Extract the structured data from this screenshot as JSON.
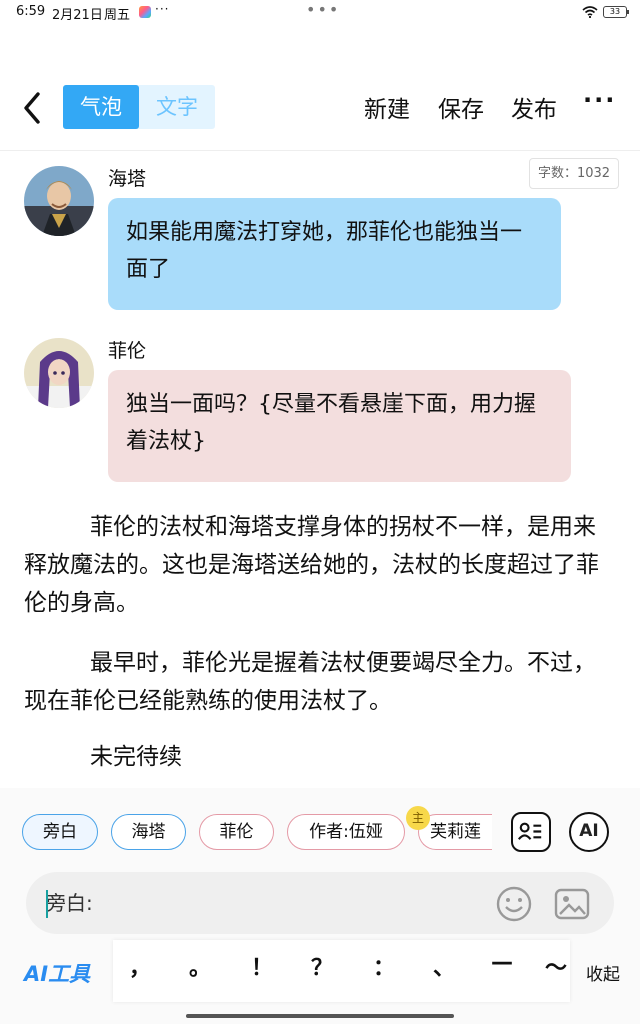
{
  "status_bar": {
    "time": "6:59",
    "date": "2月21日",
    "weekday": "周五",
    "more": "···",
    "center_dots": "•••",
    "battery": "33"
  },
  "toolbar": {
    "tab_bubble": "气泡",
    "tab_text": "文字",
    "new_label": "新建",
    "save_label": "保存",
    "publish_label": "发布",
    "more_label": "···"
  },
  "word_count": "字数：1032",
  "messages": [
    {
      "speaker": "海塔",
      "text": "如果能用魔法打穿她，那菲伦也能独当一面了",
      "bubble_color": "#a9dcfa"
    },
    {
      "speaker": "菲伦",
      "text": "独当一面吗？{尽量不看悬崖下面，用力握着法杖}",
      "bubble_color": "#f3dede"
    }
  ],
  "paragraphs": [
    "菲伦的法杖和海塔支撑身体的拐杖不一样，是用来释放魔法的。这也是海塔送给她的，法杖的长度超过了菲伦的身高。",
    "最早时，菲伦光是握着法杖便要竭尽全力。不过，现在菲伦已经能熟练的使用法杖了。",
    "未完待续"
  ],
  "characters": [
    {
      "label": "旁白",
      "color": "#4aa3e8",
      "selected": true
    },
    {
      "label": "海塔",
      "color": "#4aa3e8",
      "selected": false
    },
    {
      "label": "菲伦",
      "color": "#e49aa6",
      "selected": false
    },
    {
      "label": "作者:伍娅",
      "color": "#e49aa6",
      "selected": false
    },
    {
      "label": "芙莉莲",
      "color": "#e49aa6",
      "selected": false
    }
  ],
  "crown_badge": "主",
  "ai_button": "AI",
  "input": {
    "placeholder": "旁白:"
  },
  "ai_tools_label": "AI工具",
  "punctuation": [
    "，",
    "。",
    "！",
    "？",
    "：",
    "、",
    "—",
    "～"
  ],
  "collapse_label": "收起",
  "colors": {
    "accent": "#33a8f5",
    "bubble_haita": "#a9dcfa",
    "bubble_fern": "#f3dede"
  }
}
